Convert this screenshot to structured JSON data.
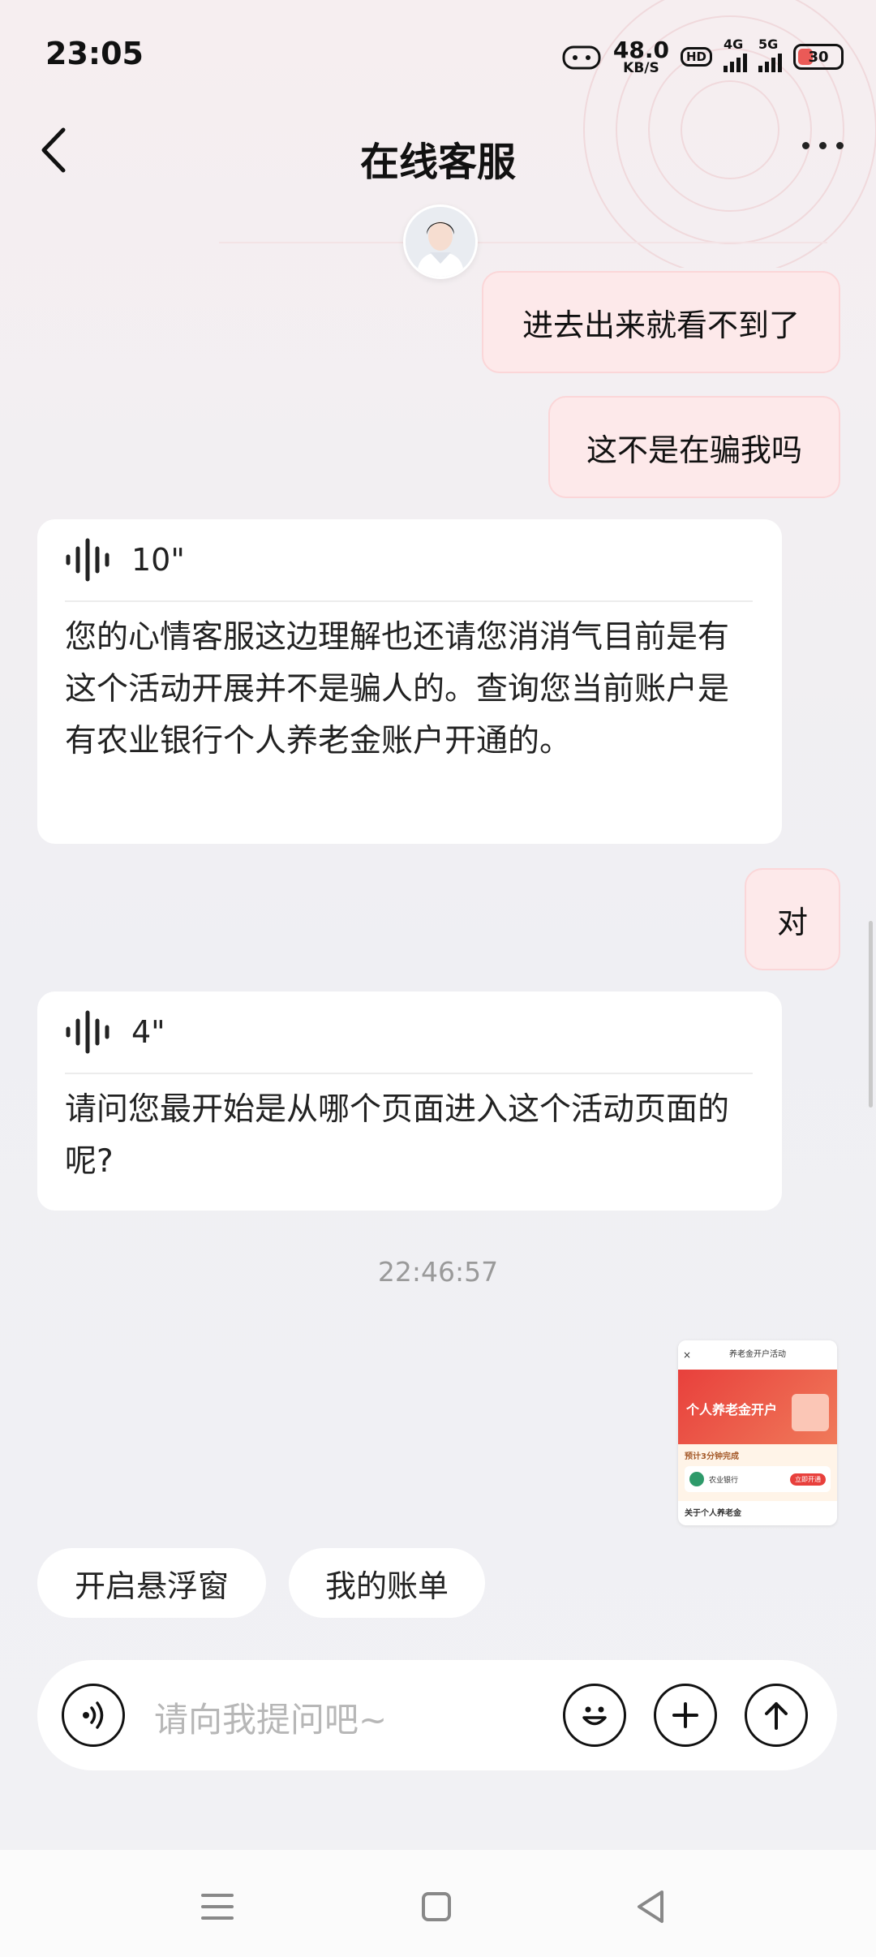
{
  "status_bar": {
    "time": "23:05",
    "net_speed_value": "48.0",
    "net_speed_unit": "KB/S",
    "hd_badge": "HD",
    "signal_4g": "4G",
    "signal_5g": "5G",
    "battery": "30",
    "battery_color": "#e8403c"
  },
  "header": {
    "title": "在线客服"
  },
  "messages": {
    "user_1": "进去出来就看不到了",
    "user_2": "这不是在骗我吗",
    "agent_1": {
      "voice_duration": "10\"",
      "text": "您的心情客服这边理解也还请您消消气目前是有这个活动开展并不是骗人的。查询您当前账户是有农业银行个人养老金账户开通的。"
    },
    "user_3": "对",
    "agent_2": {
      "voice_duration": "4\"",
      "text": "请问您最开始是从哪个页面进入这个活动页面的呢?"
    },
    "timestamp": "22:46:57",
    "image_preview": {
      "page_title": "养老金开户活动",
      "banner_title": "个人养老金开户",
      "subtitle": "预计3分钟完成",
      "bank_name": "农业银行",
      "action": "立即开通",
      "section_title": "关于个人养老金"
    }
  },
  "quick_actions": [
    "开启悬浮窗",
    "我的账单"
  ],
  "input": {
    "placeholder": "请向我提问吧~"
  },
  "colors": {
    "user_bubble": "#fde9ea",
    "agent_bubble": "#ffffff",
    "accent_red": "#e8403c"
  }
}
